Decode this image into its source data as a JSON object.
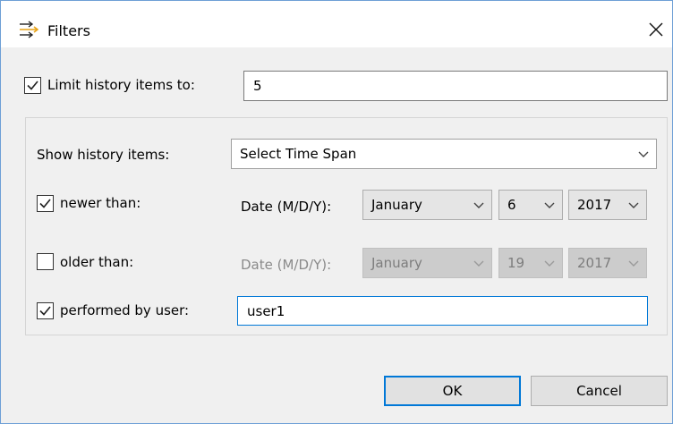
{
  "window": {
    "title": "Filters",
    "title_icon": "filter-arrows-icon",
    "close_icon": "close-icon"
  },
  "limit": {
    "checked": true,
    "label": "Limit history items to:",
    "value": "5"
  },
  "show_history": {
    "label": "Show history items:",
    "selected": "Select Time Span"
  },
  "newer": {
    "checked": true,
    "label": "newer than:",
    "date_label": "Date (M/D/Y):",
    "month": "January",
    "day": "6",
    "year": "2017"
  },
  "older": {
    "checked": false,
    "label": "older than:",
    "date_label": "Date (M/D/Y):",
    "month": "January",
    "day": "19",
    "year": "2017"
  },
  "user": {
    "checked": true,
    "label": "performed by user:",
    "value": "user1"
  },
  "buttons": {
    "ok": "OK",
    "cancel": "Cancel"
  },
  "colors": {
    "accent": "#0078d7",
    "window_border": "#6d9fd6",
    "background": "#f0f0f0"
  }
}
